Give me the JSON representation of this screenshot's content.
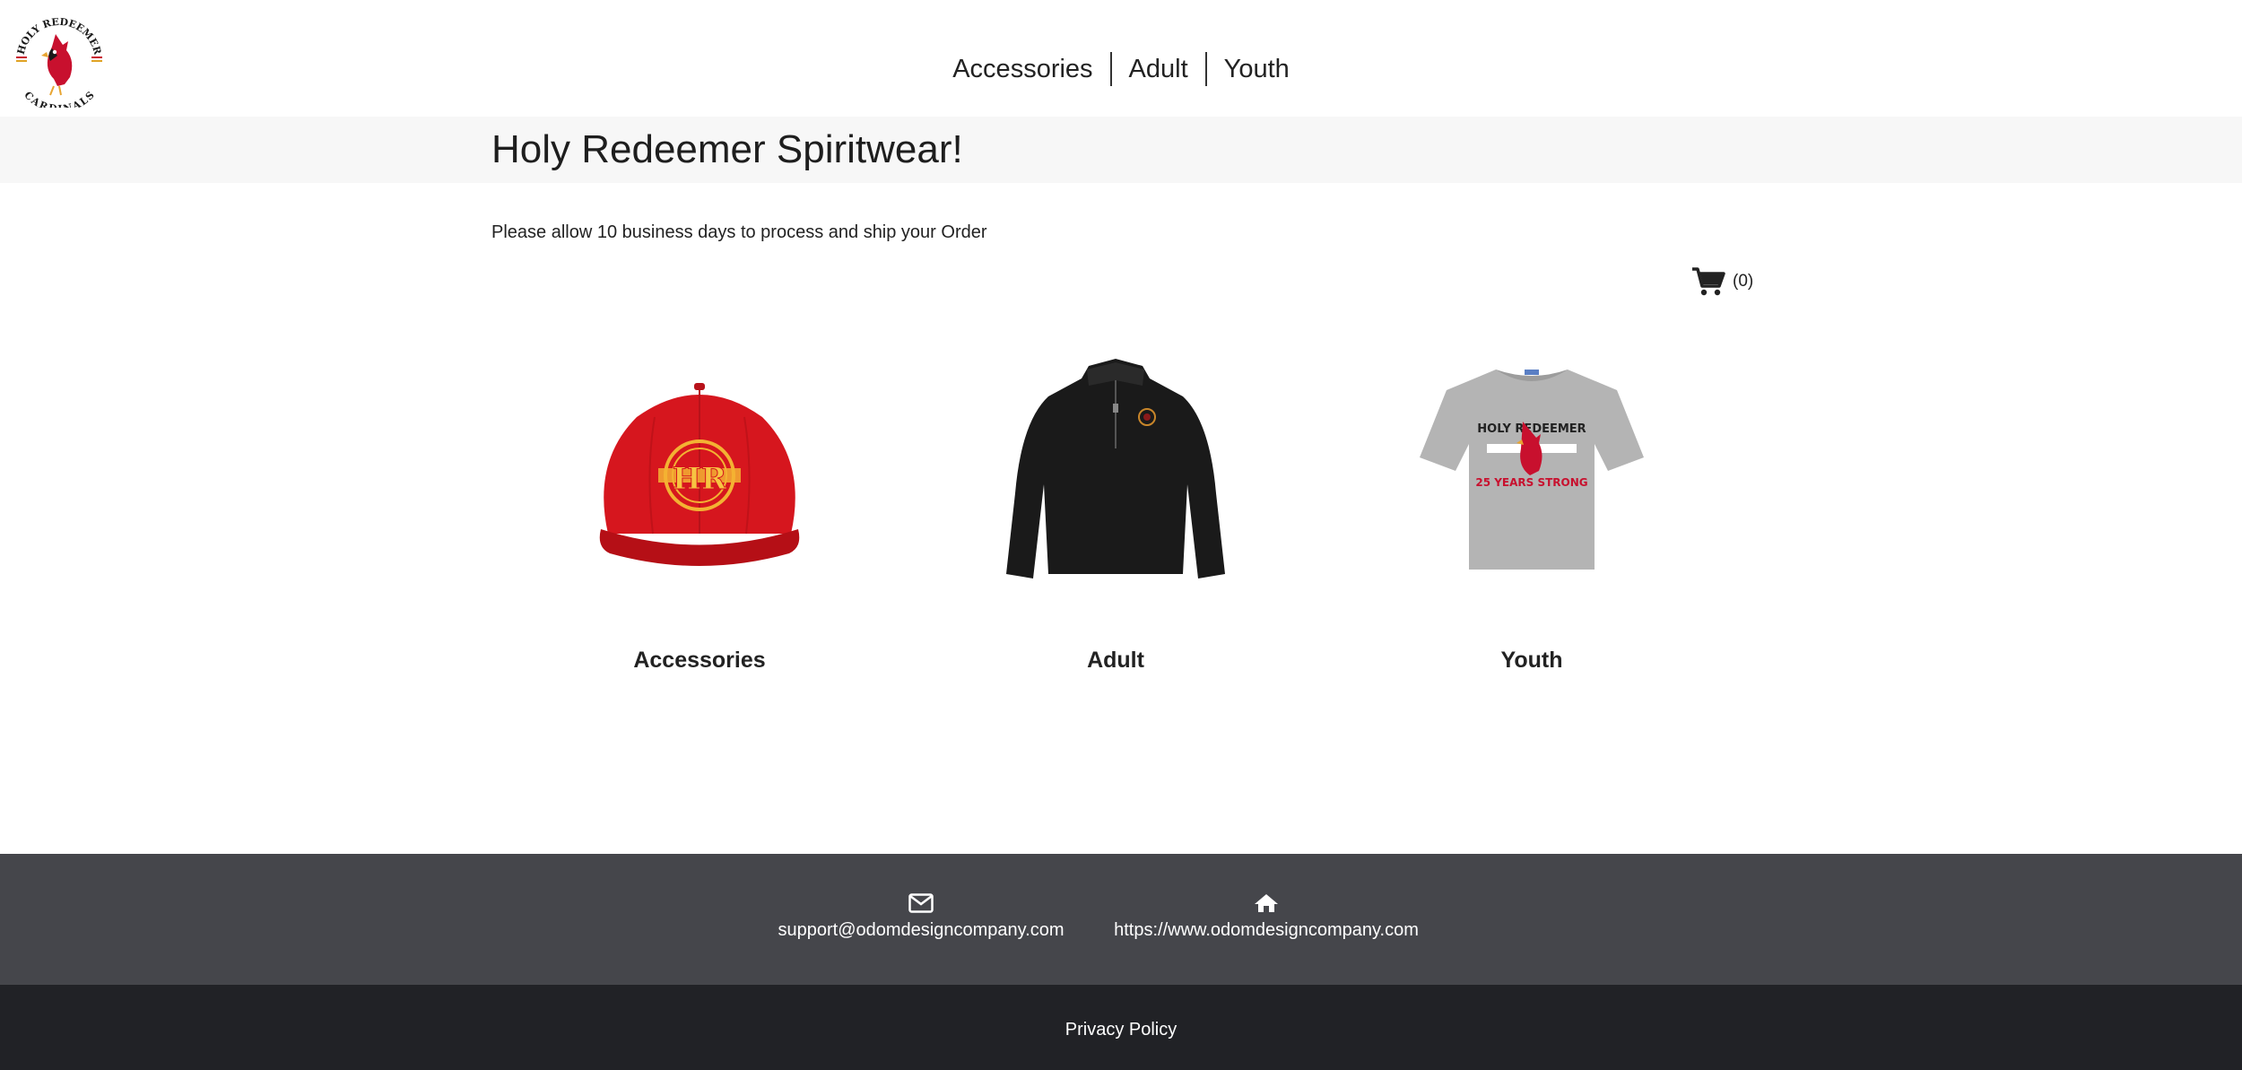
{
  "brand": {
    "logo_top_text": "HOLY REDEEMER",
    "logo_bottom_text": "CARDINALS"
  },
  "nav": {
    "items": [
      {
        "label": "Accessories"
      },
      {
        "label": "Adult"
      },
      {
        "label": "Youth"
      }
    ]
  },
  "page": {
    "title": "Holy Redeemer Spiritwear!",
    "notice": "Please allow 10 business days to process and ship your Order"
  },
  "cart": {
    "icon": "cart-icon",
    "count_label": "(0)"
  },
  "products": [
    {
      "label": "Accessories",
      "image": "red-cap",
      "badge_text": "HR"
    },
    {
      "label": "Adult",
      "image": "black-quarter-zip"
    },
    {
      "label": "Youth",
      "image": "grey-tshirt",
      "shirt_top": "HOLY REDEEMER",
      "shirt_bottom": "25 YEARS STRONG"
    }
  ],
  "footer": {
    "email": "support@odomdesigncompany.com",
    "website": "https://www.odomdesigncompany.com",
    "privacy": "Privacy Policy"
  },
  "colors": {
    "footer_top": "#45464b",
    "footer_bottom": "#212226",
    "cardinal_red": "#c8102e",
    "cap_red": "#d6161e",
    "cap_gold": "#f3b233"
  }
}
